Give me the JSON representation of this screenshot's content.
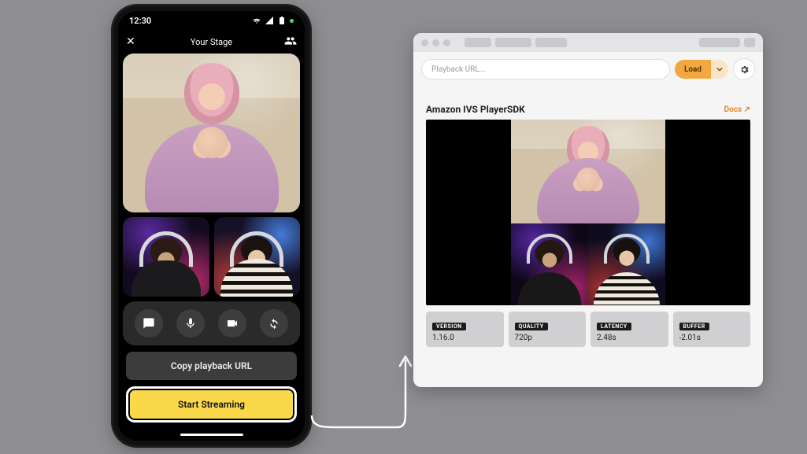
{
  "phone": {
    "status_time": "12:30",
    "appbar_title": "Your Stage",
    "controls": [
      "chat",
      "mic",
      "camera",
      "swap"
    ],
    "copy_btn": "Copy playback URL",
    "stream_btn": "Start Streaming"
  },
  "browser": {
    "url_placeholder": "Playback URL...",
    "load_label": "Load",
    "sdk_title": "Amazon IVS PlayerSDK",
    "docs_label": "Docs ↗",
    "stats": [
      {
        "label": "VERSION",
        "value": "1.16.0"
      },
      {
        "label": "QUALITY",
        "value": "720p"
      },
      {
        "label": "LATENCY",
        "value": "2.48s"
      },
      {
        "label": "BUFFER",
        "value": "-2.01s"
      }
    ]
  }
}
